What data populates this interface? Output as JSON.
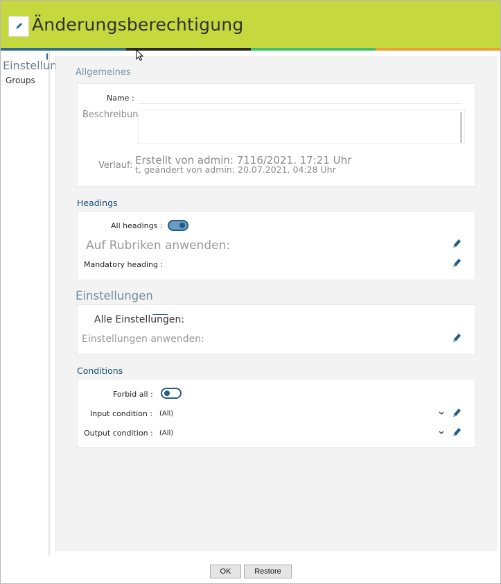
{
  "window": {
    "title": "Änderungsberechtigung",
    "accent_colors": [
      "#c5d83d",
      "#2f6f8d",
      "#2a2a2a",
      "#3cc06a",
      "#f0a030"
    ]
  },
  "sidebar": {
    "items": [
      {
        "label": "Einstellungen"
      },
      {
        "label": "Groups"
      }
    ]
  },
  "general": {
    "title": "Allgemeines",
    "name_label": "Name :",
    "name_value": "",
    "description_label": "Beschreibung:",
    "description_value": "",
    "history_label": "Verlauf:",
    "history_line1": "Erstellt von admin: 7116/2021. 17:21 Uhr",
    "history_line2": "t, geändert von admin: 20.07.2021, 04:28 Uhr"
  },
  "headings": {
    "title": "Headings",
    "all_label": "All headings :",
    "all_state": "on",
    "apply_label": "Auf Rubriken anwenden:",
    "mandatory_label": "Mandatory heading :"
  },
  "settings": {
    "title": "Einstellungen",
    "all_label": "Alle Einstellungen:",
    "apply_label": "Einstellungen anwenden:"
  },
  "conditions": {
    "title": "Conditions",
    "forbid_label": "Forbid all :",
    "forbid_state": "off",
    "input_label": "Input condition :",
    "input_value": "(All)",
    "output_label": "Output condition :",
    "output_value": "(All)"
  },
  "footer": {
    "ok_label": "OK",
    "restore_label": "Restore"
  },
  "icons": {
    "header": "edit-icon",
    "edit": "pencil-icon",
    "dropdown": "chevron-down-icon",
    "cursor": "mouse-pointer-icon"
  }
}
